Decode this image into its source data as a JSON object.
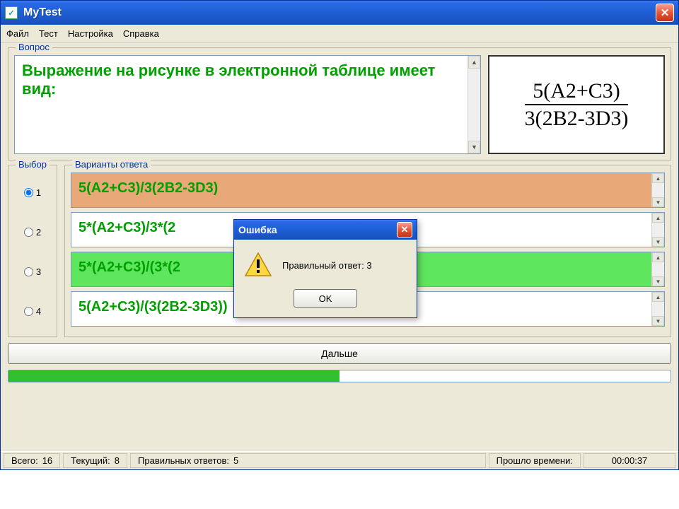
{
  "window": {
    "title": "MyTest"
  },
  "menu": {
    "file": "Файл",
    "test": "Тест",
    "settings": "Настройка",
    "help": "Справка"
  },
  "question": {
    "group_label": "Вопрос",
    "text": "Выражение на рисунке в электронной таблице имеет вид:",
    "formula_numerator": "5(A2+C3)",
    "formula_denominator": "3(2B2-3D3)"
  },
  "choice": {
    "group_label": "Выбор",
    "labels": [
      "1",
      "2",
      "3",
      "4"
    ],
    "selected_index": 0
  },
  "answers": {
    "group_label": "Варианты ответа",
    "items": [
      {
        "text": "5(A2+C3)/3(2B2-3D3)",
        "highlight": "orange"
      },
      {
        "text": "5*(A2+C3)/3*(2",
        "highlight": ""
      },
      {
        "text": "5*(A2+C3)/(3*(2",
        "highlight": "green"
      },
      {
        "text": "5(A2+C3)/(3(2B2-3D3))",
        "highlight": ""
      }
    ]
  },
  "next_button": "Дальше",
  "progress_percent": 50,
  "status": {
    "total_label": "Всего:",
    "total_value": "16",
    "current_label": "Текущий:",
    "current_value": "8",
    "correct_label": "Правильных ответов:",
    "correct_value": "5",
    "elapsed_label": "Прошло времени:",
    "elapsed_value": "00:00:37"
  },
  "dialog": {
    "title": "Ошибка",
    "message": "Правильный ответ: 3",
    "ok": "OK"
  }
}
